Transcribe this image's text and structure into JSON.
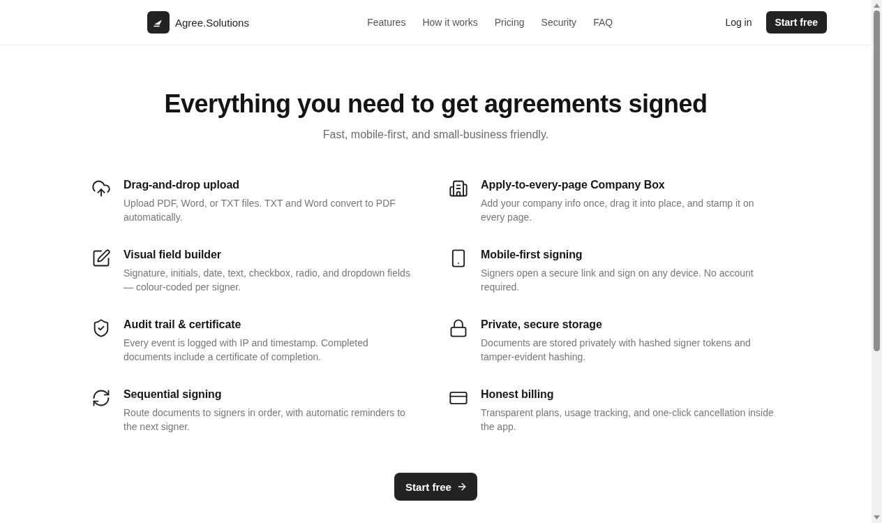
{
  "header": {
    "brand": "Agree.Solutions",
    "nav": [
      "Features",
      "How it works",
      "Pricing",
      "Security",
      "FAQ"
    ],
    "login": "Log in",
    "cta": "Start free"
  },
  "hero": {
    "title": "Everything you need to get agreements signed",
    "subtitle": "Fast, mobile-first, and small-business friendly."
  },
  "features": [
    {
      "title": "Drag-and-drop upload",
      "description": "Upload PDF, Word, or TXT files. TXT and Word convert to PDF automatically."
    },
    {
      "title": "Apply-to-every-page Company Box",
      "description": "Add your company info once, drag it into place, and stamp it on every page."
    },
    {
      "title": "Visual field builder",
      "description": "Signature, initials, date, text, checkbox, radio, and dropdown fields — colour-coded per signer."
    },
    {
      "title": "Mobile-first signing",
      "description": "Signers open a secure link and sign on any device. No account required."
    },
    {
      "title": "Audit trail & certificate",
      "description": "Every event is logged with IP and timestamp. Completed documents include a certificate of completion."
    },
    {
      "title": "Private, secure storage",
      "description": "Documents are stored privately with hashed signer tokens and tamper-evident hashing."
    },
    {
      "title": "Sequential signing",
      "description": "Route documents to signers in order, with automatic reminders to the next signer."
    },
    {
      "title": "Honest billing",
      "description": "Transparent plans, usage tracking, and one-click cancellation inside the app."
    }
  ],
  "cta_button": "Start free"
}
